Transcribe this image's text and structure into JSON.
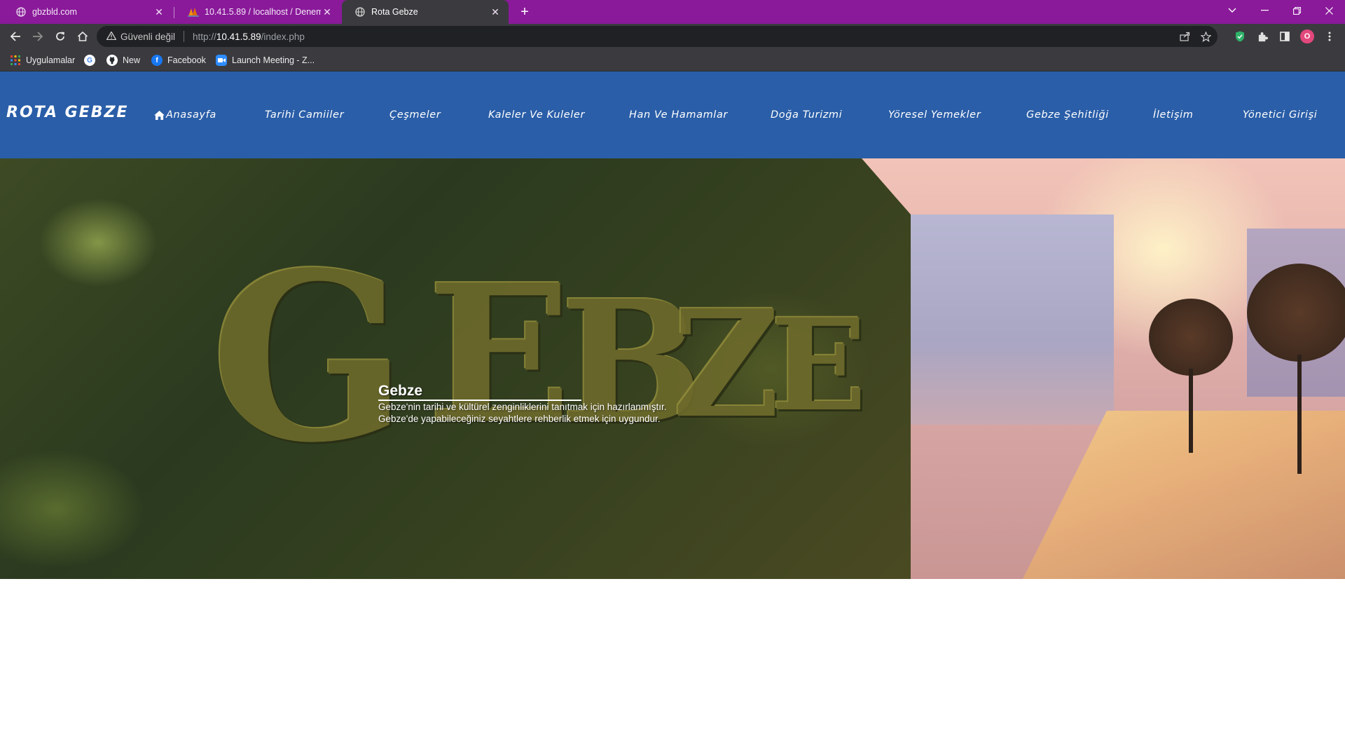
{
  "browser": {
    "tabs": [
      {
        "title": "gbzbld.com",
        "icon": "globe-icon",
        "active": false
      },
      {
        "title": "10.41.5.89 / localhost / Deneme /",
        "icon": "phpmyadmin-icon",
        "active": false
      },
      {
        "title": "Rota Gebze",
        "icon": "globe-icon",
        "active": true
      }
    ],
    "new_tab_label": "+",
    "address": {
      "warning_icon": "warning-icon",
      "security_status": "Güvenli değil",
      "url_prefix": "http://",
      "url_host": "10.41.5.89",
      "url_path": "/index.php"
    },
    "bookmarks": [
      {
        "label": "Uygulamalar",
        "icon": "apps-grid-icon"
      },
      {
        "label": "",
        "icon": "google-icon"
      },
      {
        "label": "New",
        "icon": "github-icon"
      },
      {
        "label": "Facebook",
        "icon": "facebook-icon"
      },
      {
        "label": "Launch Meeting - Z...",
        "icon": "zoom-icon"
      }
    ],
    "profile_initial": "O"
  },
  "site": {
    "brand": "ROTA GEBZE",
    "nav": [
      {
        "label": "Anasayfa",
        "icon": "home-icon"
      },
      {
        "label": "Tarihi Camiiler"
      },
      {
        "label": "Çeşmeler"
      },
      {
        "label": "Kaleler Ve Kuleler"
      },
      {
        "label": "Han Ve Hamamlar"
      },
      {
        "label": "Doğa Turizmi"
      },
      {
        "label": "Yöresel Yemekler"
      },
      {
        "label": "Gebze Şehitliği"
      },
      {
        "label": "İletişim"
      },
      {
        "label": "Yönetici Girişi"
      }
    ],
    "hero": {
      "title": "Gebze",
      "line1": "Gebze'nin tarihi ve kültürel zenginliklerini tanıtmak için hazırlanmıştır.",
      "line2": "Gebze'de yapabileceğiniz seyahtlere rehberlik etmek için uygundur."
    }
  },
  "colors": {
    "tabbar": "#8a1a9a",
    "chrome": "#3b3b3f",
    "nav_bg": "#2a5ea8"
  }
}
